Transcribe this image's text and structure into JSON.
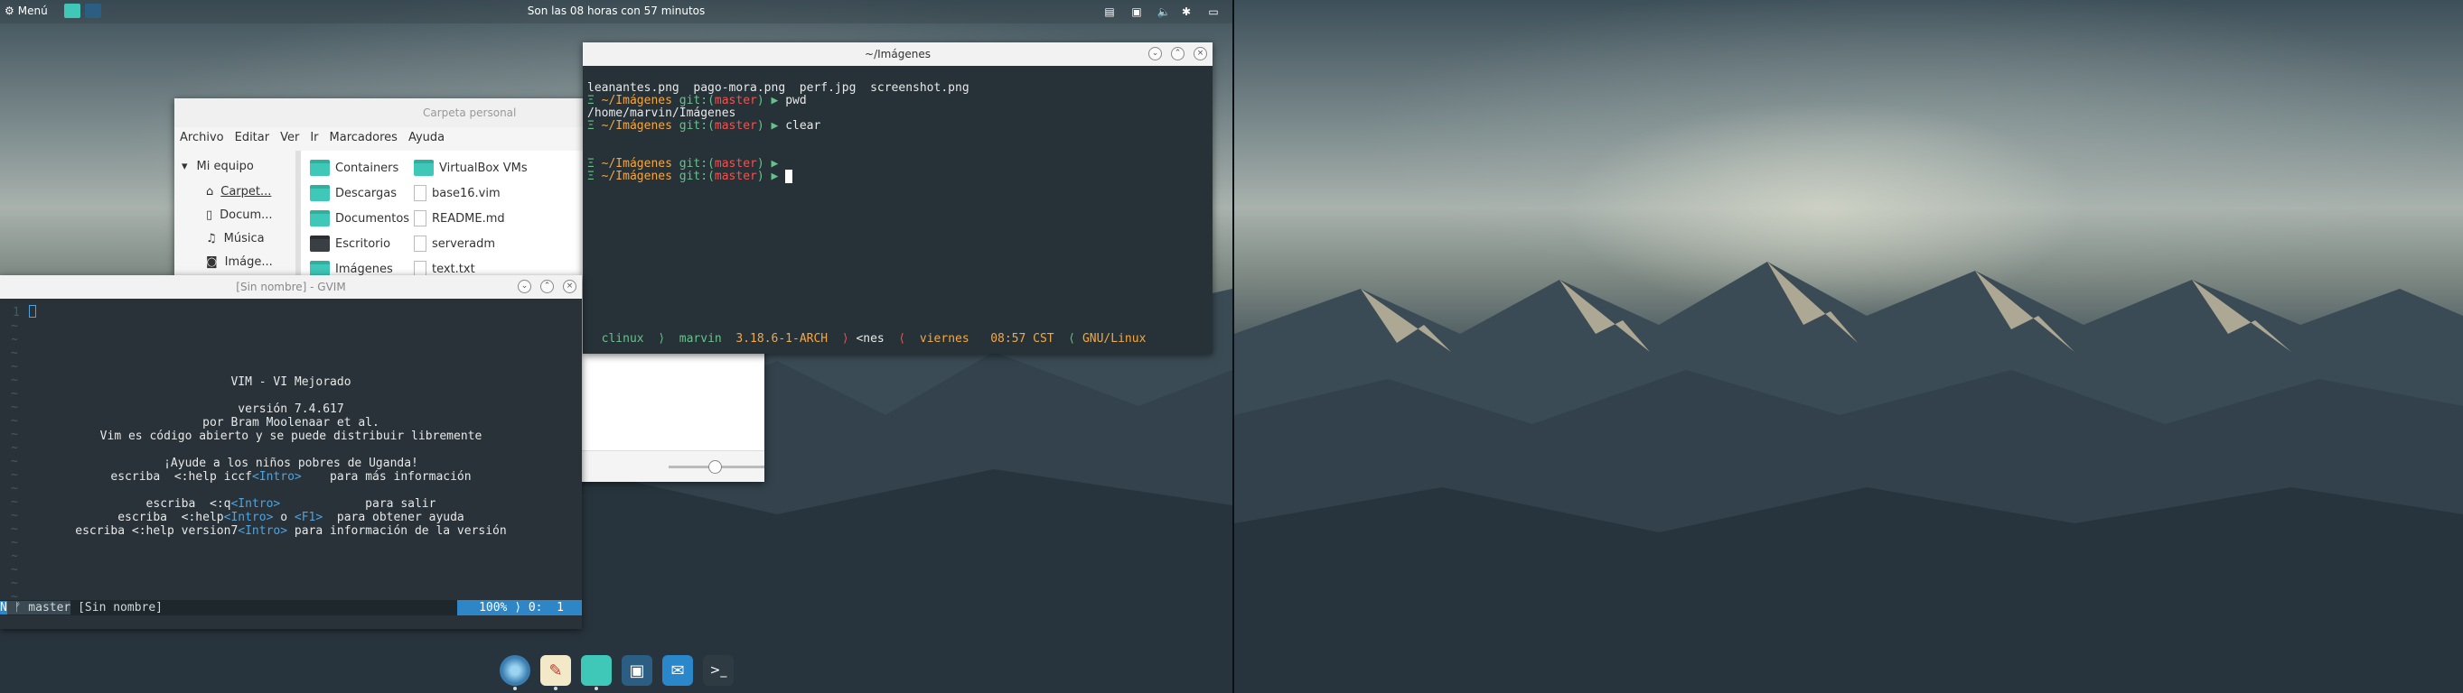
{
  "panel": {
    "menu_label": "Menú",
    "clock": "Son las 08 horas con 57 minutos"
  },
  "file_manager": {
    "title": "Carpeta personal",
    "menus": [
      "Archivo",
      "Editar",
      "Ver",
      "Ir",
      "Marcadores",
      "Ayuda"
    ],
    "sidebar_header": "Mi equipo",
    "sidebar_items": [
      "Carpet...",
      "Docum...",
      "Música",
      "Imáge..."
    ],
    "items": [
      "Containers",
      "VirtualBox VMs",
      "Descargas",
      "base16.vim",
      "Documentos",
      "README.md",
      "Escritorio",
      "serveradm",
      "Imágenes",
      "text.txt"
    ]
  },
  "terminal": {
    "title": "~/Imágenes",
    "line1": "leanantes.png  pago-mora.png  perf.jpg  screenshot.png",
    "prompt_path": "~/Imágenes",
    "git_label": "git:(",
    "branch": "master",
    "git_close": ")",
    "cmd_pwd": "pwd",
    "pwd_output": "/home/marvin/Imágenes",
    "cmd_clear": "clear",
    "status": {
      "host": "clinux",
      "user": "marvin",
      "kernel": "3.18.6-1-ARCH",
      "mode": "<nes",
      "day": "viernes",
      "time": "08:57 CST",
      "os": "GNU/Linux"
    }
  },
  "gvim": {
    "title": "[Sin nombre] - GVIM",
    "intro": [
      "VIM - VI Mejorado",
      "",
      "versión 7.4.617",
      "por Bram Moolenaar et al.",
      "Vim es código abierto y se puede distribuir libremente",
      "",
      "¡Ayude a los niños pobres de Uganda!",
      "escriba  <:help iccf<Intro>    para más información",
      "",
      "escriba  <:q<Intro>            para salir",
      "escriba  <:help<Intro> o <F1>  para obtener ayuda",
      "escriba <:help version7<Intro> para información de la versión"
    ],
    "statusline": {
      "mode": "N",
      "branch": "master",
      "file": "[Sin nombre]",
      "percent": "100%",
      "position": "0:  1"
    }
  },
  "dock": {
    "apps": [
      "chromium-icon",
      "text-editor-icon",
      "files-icon",
      "disks-icon",
      "mail-icon",
      "terminal-icon"
    ]
  },
  "colors": {
    "accent": "#3fc7b8",
    "vim_status": "#2f86c6",
    "terminal_bg": "#263238"
  }
}
